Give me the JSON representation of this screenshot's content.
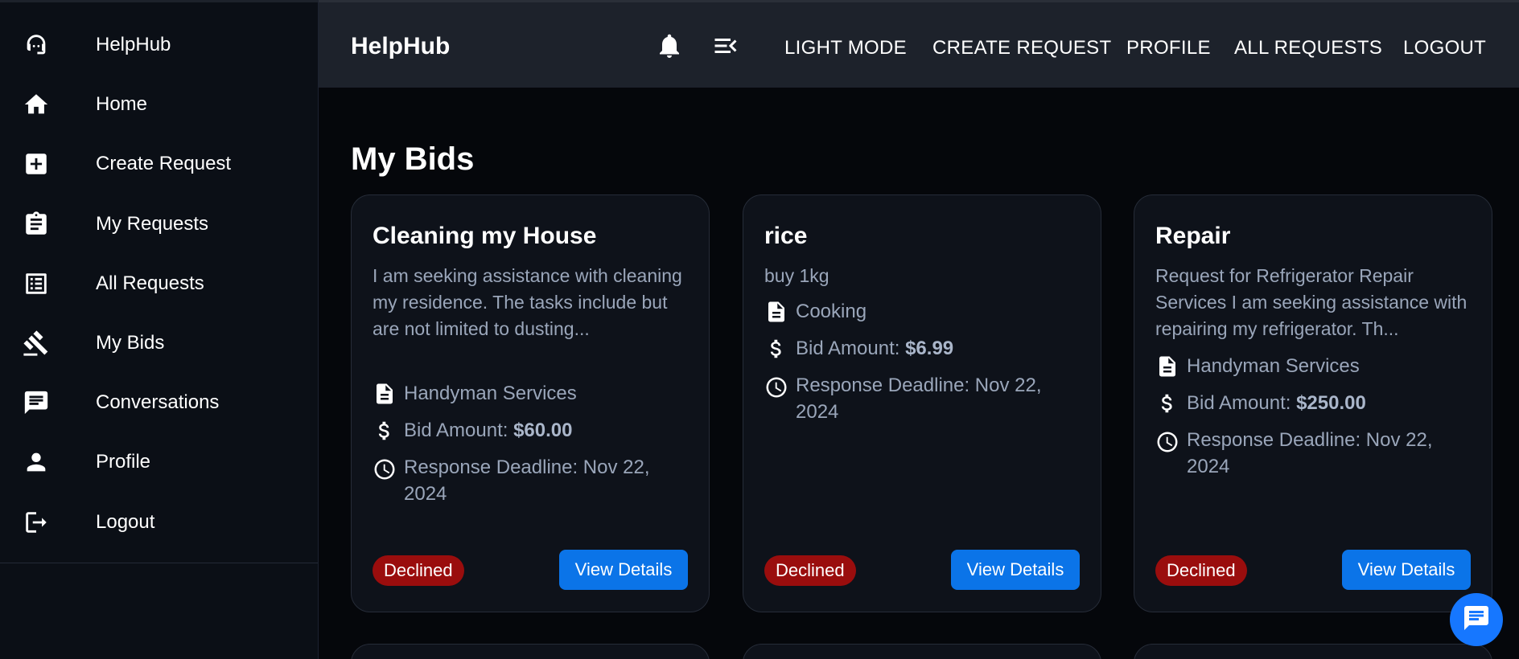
{
  "sidebar": {
    "items": [
      {
        "label": "HelpHub",
        "icon": "support-agent-icon"
      },
      {
        "label": "Home",
        "icon": "home-icon"
      },
      {
        "label": "Create Request",
        "icon": "add-box-icon"
      },
      {
        "label": "My Requests",
        "icon": "clipboard-icon"
      },
      {
        "label": "All Requests",
        "icon": "list-icon"
      },
      {
        "label": "My Bids",
        "icon": "gavel-icon"
      },
      {
        "label": "Conversations",
        "icon": "chat-icon"
      },
      {
        "label": "Profile",
        "icon": "person-icon"
      },
      {
        "label": "Logout",
        "icon": "logout-icon"
      }
    ]
  },
  "header": {
    "brand": "HelpHub",
    "icons": [
      "bell-icon",
      "menu-collapse-icon"
    ],
    "nav": [
      "LIGHT MODE",
      "CREATE REQUEST",
      "PROFILE",
      "ALL REQUESTS",
      "LOGOUT"
    ]
  },
  "main": {
    "title": "My Bids",
    "cards": [
      {
        "title": "Cleaning my House",
        "description": "I am seeking assistance with cleaning my residence. The tasks include but are not limited to dusting...",
        "category": "Handyman Services",
        "bid_label": "Bid Amount: ",
        "bid_amount": "$60.00",
        "deadline": "Response Deadline: Nov 22, 2024",
        "status": "Declined",
        "button": "View Details"
      },
      {
        "title": "rice",
        "description": "buy 1kg",
        "category": "Cooking",
        "bid_label": "Bid Amount: ",
        "bid_amount": "$6.99",
        "deadline": "Response Deadline: Nov 22, 2024",
        "status": "Declined",
        "button": "View Details"
      },
      {
        "title": "Repair",
        "description": "Request for Refrigerator Repair Services I am seeking assistance with repairing my refrigerator. Th...",
        "category": "Handyman Services",
        "bid_label": "Bid Amount: ",
        "bid_amount": "$250.00",
        "deadline": "Response Deadline: Nov 22, 2024",
        "status": "Declined",
        "button": "View Details"
      }
    ]
  },
  "fab": {
    "icon": "chat-bubble-icon"
  },
  "colors": {
    "background": "#05070b",
    "sidebar": "#0b0f16",
    "topbar": "#1d222b",
    "card": "#0e121a",
    "status_declined": "#9a0d0d",
    "primary_button": "#0b74e8",
    "muted_text": "#9aa6ba"
  }
}
